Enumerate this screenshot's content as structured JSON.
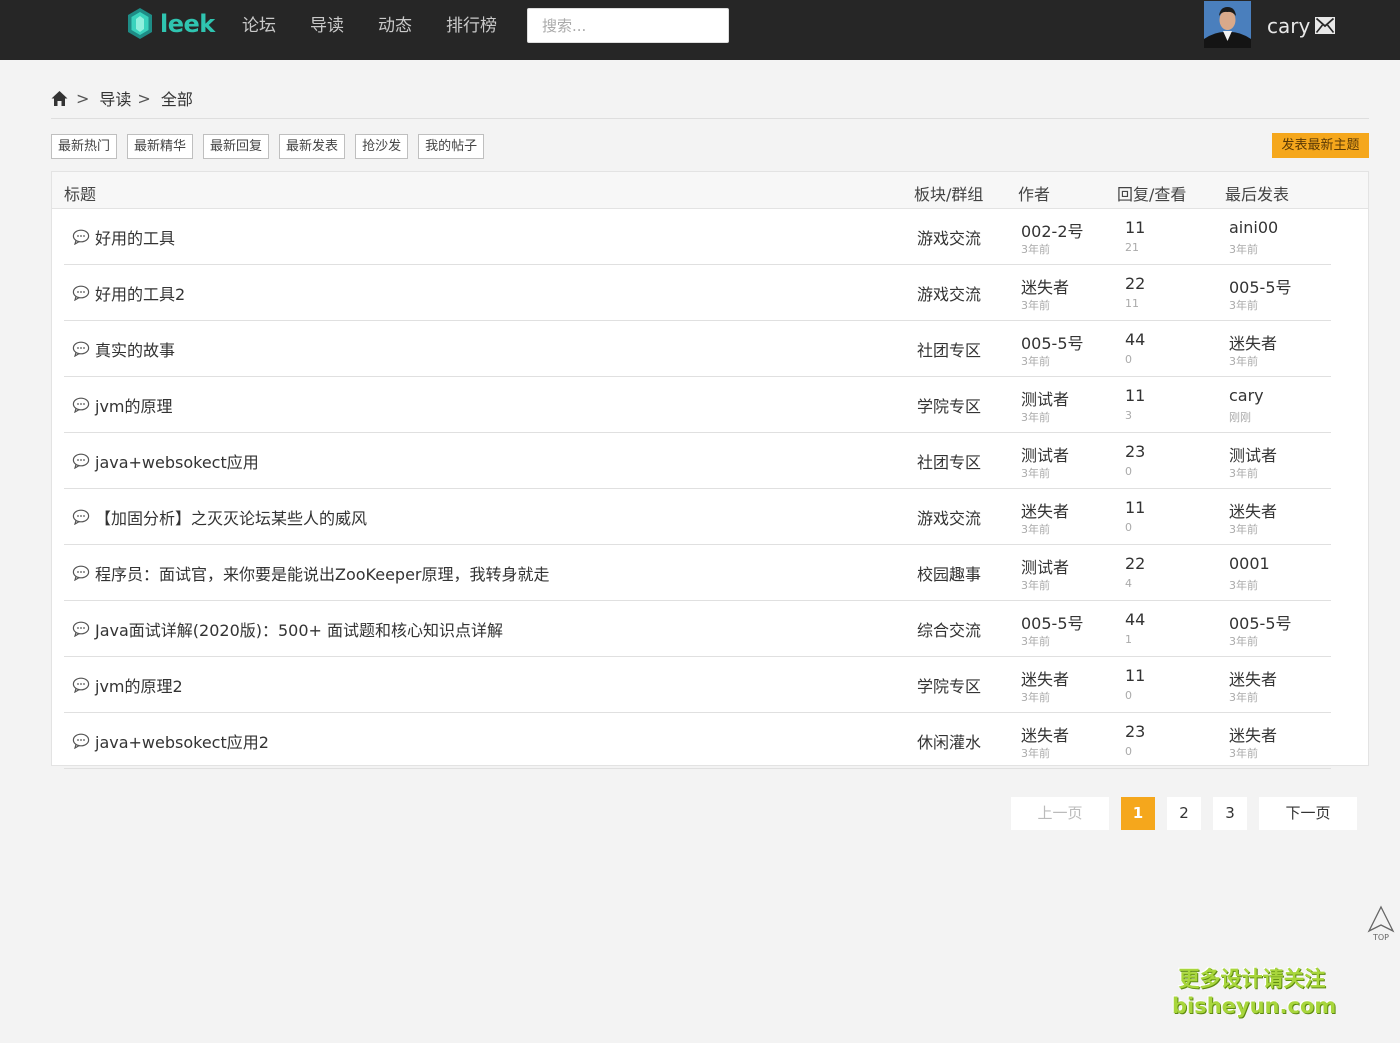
{
  "brand": {
    "name": "leek",
    "color": "#2fc4b0"
  },
  "nav": [
    {
      "label": "论坛"
    },
    {
      "label": "导读"
    },
    {
      "label": "动态"
    },
    {
      "label": "排行榜"
    }
  ],
  "search": {
    "placeholder": "搜索...",
    "value": ""
  },
  "user": {
    "name": "cary"
  },
  "breadcrumb": {
    "level1": "导读",
    "level2": "全部",
    "separator": ">"
  },
  "filters": [
    "最新热门",
    "最新精华",
    "最新回复",
    "最新发表",
    "抢沙发",
    "我的帖子"
  ],
  "post_button": "发表最新主题",
  "table": {
    "headers": {
      "title": "标题",
      "board": "板块/群组",
      "author": "作者",
      "stats": "回复/查看",
      "last": "最后发表"
    },
    "rows": [
      {
        "title": "好用的工具",
        "board": "游戏交流",
        "author": "002-2号",
        "author_time": "3年前",
        "replies": "11",
        "views": "21",
        "last_user": "aini00",
        "last_time": "3年前"
      },
      {
        "title": "好用的工具2",
        "board": "游戏交流",
        "author": "迷失者",
        "author_time": "3年前",
        "replies": "22",
        "views": "11",
        "last_user": "005-5号",
        "last_time": "3年前"
      },
      {
        "title": "真实的故事",
        "board": "社团专区",
        "author": "005-5号",
        "author_time": "3年前",
        "replies": "44",
        "views": "0",
        "last_user": "迷失者",
        "last_time": "3年前"
      },
      {
        "title": "jvm的原理",
        "board": "学院专区",
        "author": "测试者",
        "author_time": "3年前",
        "replies": "11",
        "views": "3",
        "last_user": "cary",
        "last_time": "刚刚"
      },
      {
        "title": "java+websokect应用",
        "board": "社团专区",
        "author": "测试者",
        "author_time": "3年前",
        "replies": "23",
        "views": "0",
        "last_user": "测试者",
        "last_time": "3年前"
      },
      {
        "title": "【加固分析】之灭灭论坛某些人的威风",
        "board": "游戏交流",
        "author": "迷失者",
        "author_time": "3年前",
        "replies": "11",
        "views": "0",
        "last_user": "迷失者",
        "last_time": "3年前"
      },
      {
        "title": "程序员：面试官，来你要是能说出ZooKeeper原理，我转身就走",
        "board": "校园趣事",
        "author": "测试者",
        "author_time": "3年前",
        "replies": "22",
        "views": "4",
        "last_user": "0001",
        "last_time": "3年前"
      },
      {
        "title": "Java面试详解(2020版)：500+ 面试题和核心知识点详解",
        "board": "综合交流",
        "author": "005-5号",
        "author_time": "3年前",
        "replies": "44",
        "views": "1",
        "last_user": "005-5号",
        "last_time": "3年前"
      },
      {
        "title": "jvm的原理2",
        "board": "学院专区",
        "author": "迷失者",
        "author_time": "3年前",
        "replies": "11",
        "views": "0",
        "last_user": "迷失者",
        "last_time": "3年前"
      },
      {
        "title": "java+websokect应用2",
        "board": "休闲灌水",
        "author": "迷失者",
        "author_time": "3年前",
        "replies": "23",
        "views": "0",
        "last_user": "迷失者",
        "last_time": "3年前"
      }
    ]
  },
  "pagination": {
    "prev": "上一页",
    "pages": [
      "1",
      "2",
      "3"
    ],
    "current": "1",
    "next": "下一页"
  },
  "back_to_top": "TOP",
  "watermark": {
    "line1": "更多设计请关注",
    "line2": "bisheyun.com"
  },
  "colors": {
    "accent": "#f5a71c",
    "topbar": "#262626"
  }
}
